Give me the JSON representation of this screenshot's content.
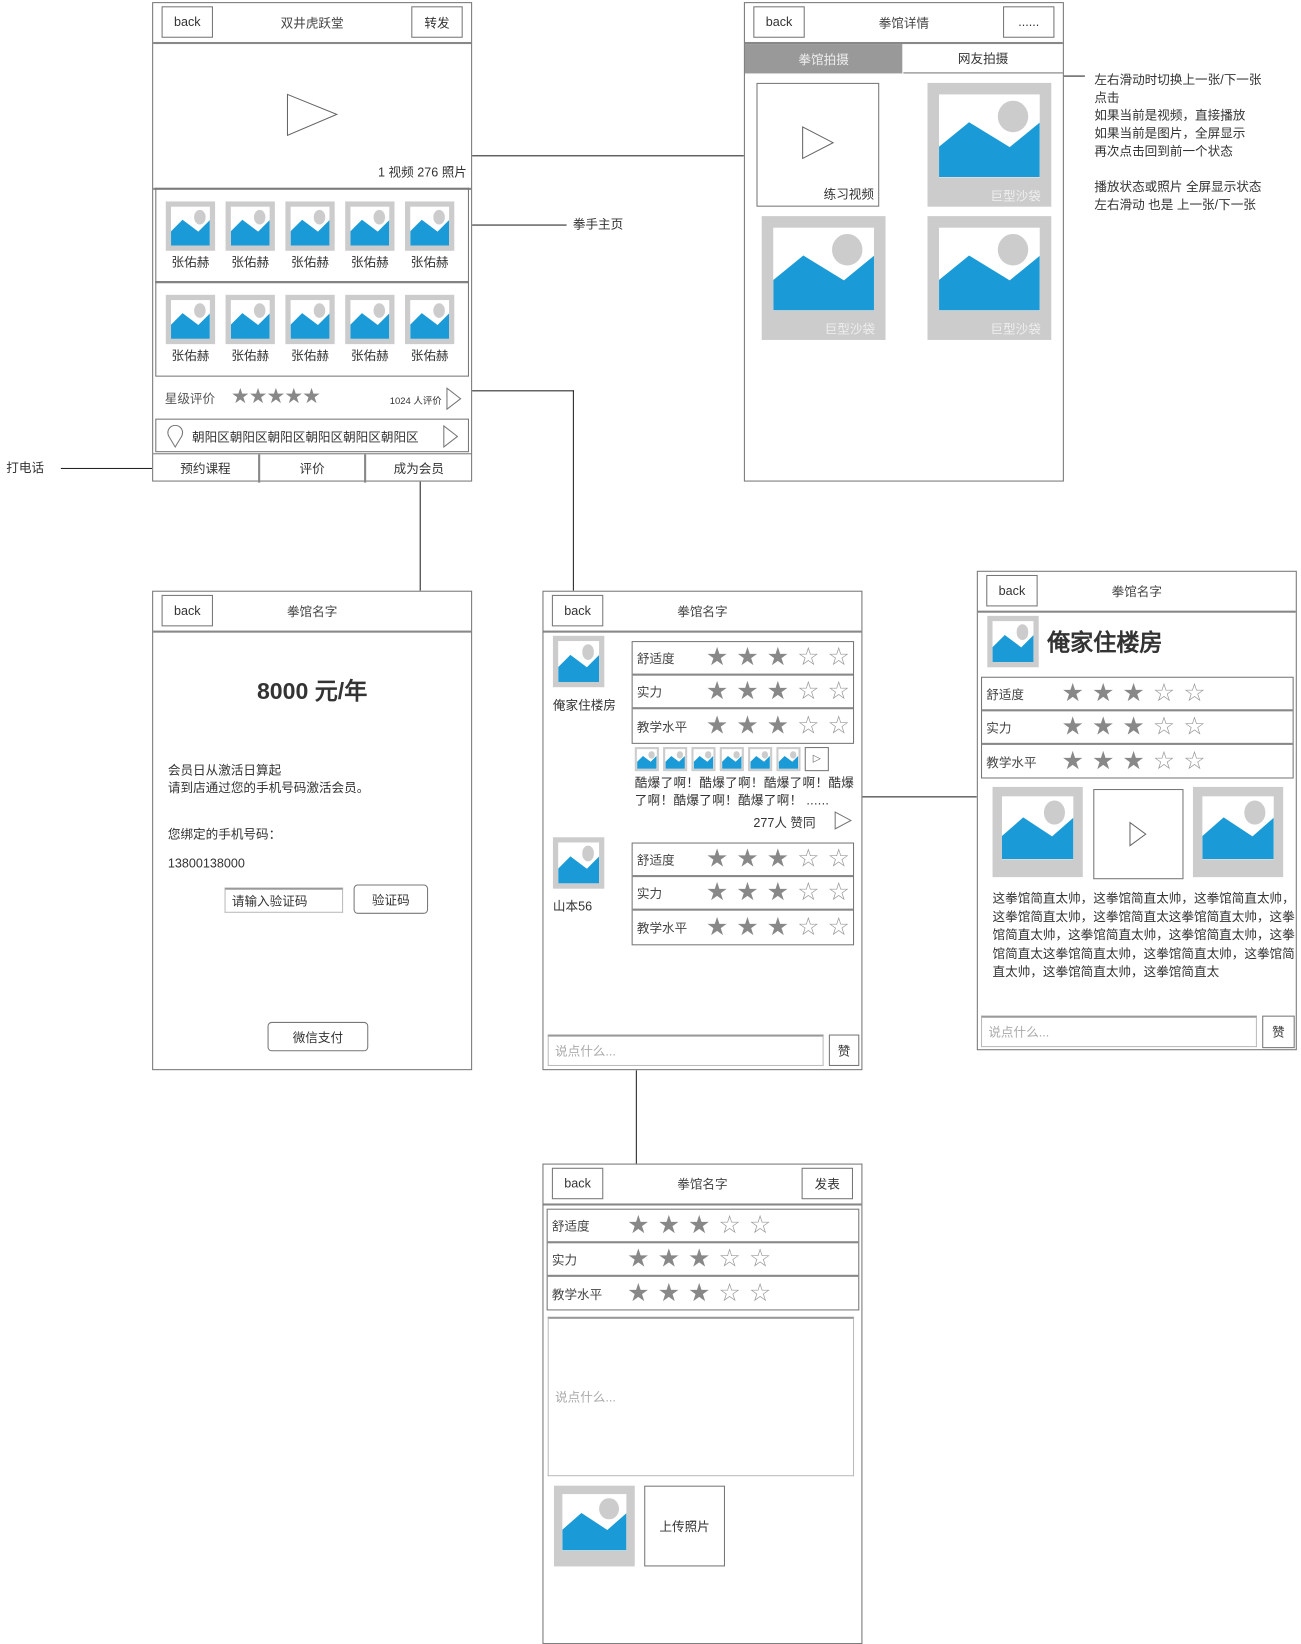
{
  "common": {
    "back": "back",
    "placeholder": "说点什么...",
    "like": "赞"
  },
  "annotations": {
    "call": "打电话",
    "boxer_home": "拳手主页",
    "swipe_notes": [
      "左右滑动时切换上一张/下一张",
      "点击",
      "如果当前是视频，直接播放",
      "如果当前是图片，全屏显示",
      "再次点击回到前一个状态",
      "",
      "播放状态或照片 全屏显示状态",
      "左右滑动 也是 上一张/下一张"
    ]
  },
  "gym_home": {
    "title": "双井虎跃堂",
    "share": "转发",
    "media_count": "1 视频 276 照片",
    "boxers": [
      "张佑赫",
      "张佑赫",
      "张佑赫",
      "张佑赫",
      "张佑赫",
      "张佑赫",
      "张佑赫",
      "张佑赫",
      "张佑赫",
      "张佑赫"
    ],
    "rating_label": "星级评价",
    "rating": 5,
    "rating_count": "1024 人评价",
    "address": "朝阳区朝阳区朝阳区朝阳区朝阳区朝阳区",
    "tabs": [
      "预约课程",
      "评价",
      "成为会员"
    ]
  },
  "gym_detail": {
    "title": "拳馆详情",
    "more": "......",
    "tabs": [
      "拳馆拍摄",
      "网友拍摄"
    ],
    "items": [
      {
        "type": "video",
        "caption": "练习视频"
      },
      {
        "type": "image",
        "caption": "巨型沙袋"
      },
      {
        "type": "image",
        "caption": "巨型沙袋"
      },
      {
        "type": "image",
        "caption": "巨型沙袋"
      }
    ]
  },
  "membership": {
    "title": "拳馆名字",
    "price": "8000 元/年",
    "info_lines": [
      "会员日从激活日算起",
      "请到店通过您的手机号码激活会员。"
    ],
    "phone_label": "您绑定的手机号码：",
    "phone": "13800138000",
    "code_placeholder": "请输入验证码",
    "code_button": "验证码",
    "pay_button": "微信支付"
  },
  "reviews": {
    "title": "拳馆名字",
    "items": [
      {
        "user": "俺家住楼房",
        "ratings": [
          {
            "label": "舒适度",
            "value": 3
          },
          {
            "label": "实力",
            "value": 3
          },
          {
            "label": "教学水平",
            "value": 3
          }
        ],
        "comment": "酷爆了啊！酷爆了啊！酷爆了啊！酷爆了啊！酷爆了啊！酷爆了啊！ ......",
        "likes": "277人 赞同"
      },
      {
        "user": "山本56",
        "ratings": [
          {
            "label": "舒适度",
            "value": 3
          },
          {
            "label": "实力",
            "value": 3
          },
          {
            "label": "教学水平",
            "value": 3
          }
        ]
      }
    ]
  },
  "review_detail": {
    "title": "拳馆名字",
    "user": "俺家住楼房",
    "ratings": [
      {
        "label": "舒适度",
        "value": 3
      },
      {
        "label": "实力",
        "value": 3
      },
      {
        "label": "教学水平",
        "value": 3
      }
    ],
    "text": "这拳馆简直太帅，这拳馆简直太帅，这拳馆简直太帅，这拳馆简直太帅，这拳馆简直太这拳馆简直太帅，这拳馆简直太帅，这拳馆简直太帅，这拳馆简直太帅，这拳馆简直太这拳馆简直太帅，这拳馆简直太帅，这拳馆简直太帅，这拳馆简直太帅，这拳馆简直太"
  },
  "write_review": {
    "title": "拳馆名字",
    "publish": "发表",
    "ratings": [
      {
        "label": "舒适度",
        "value": 3
      },
      {
        "label": "实力",
        "value": 3
      },
      {
        "label": "教学水平",
        "value": 3
      }
    ],
    "upload": "上传照片"
  },
  "colors": {
    "image_blue": "#1a9ad6",
    "placeholder_gray": "#cccccc",
    "active_tab": "#999999"
  }
}
